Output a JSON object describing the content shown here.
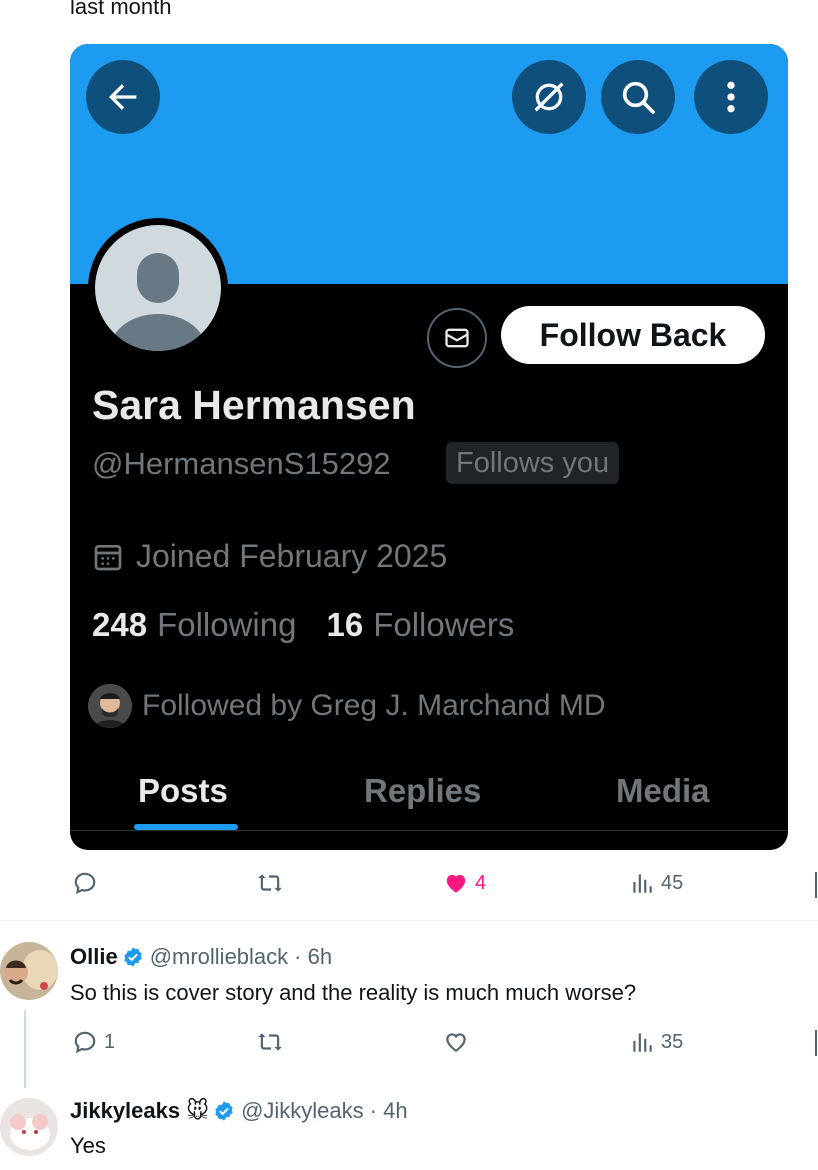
{
  "top": {
    "timestamp": "last month"
  },
  "profile": {
    "name": "Sara Hermansen",
    "handle": "@HermansenS15292",
    "follows_you": "Follows you",
    "follow_back": "Follow Back",
    "joined": "Joined February 2025",
    "following_count": "248",
    "following_label": "Following",
    "followers_count": "16",
    "followers_label": "Followers",
    "followed_by": "Followed by Greg J. Marchand MD",
    "tabs": [
      {
        "label": "Posts"
      },
      {
        "label": "Replies"
      },
      {
        "label": "Media"
      }
    ],
    "banner_color": "#1d9bf0"
  },
  "tweet_actions": {
    "likes": "4",
    "views": "45",
    "like_color": "#f91880"
  },
  "replies": [
    {
      "name": "Ollie",
      "handle": "@mrollieblack",
      "time": "· 6h",
      "text": "So this is cover story and the reality is much much worse?",
      "reply_count": "1",
      "views": "35"
    },
    {
      "name": "Jikkyleaks",
      "emoji": "🐭",
      "handle": "@Jikkyleaks",
      "time": "· 4h",
      "text": "Yes"
    }
  ]
}
